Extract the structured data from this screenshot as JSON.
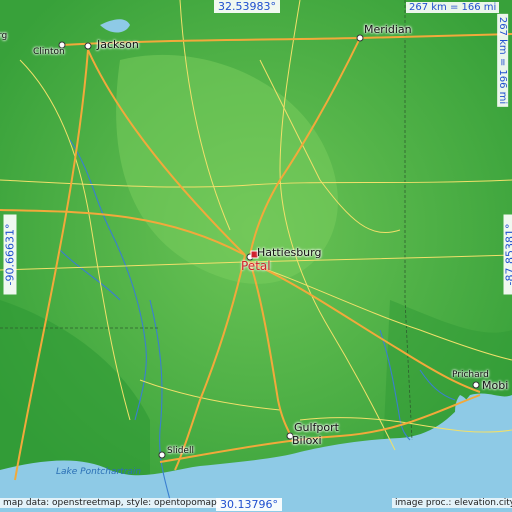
{
  "coordinates": {
    "top": "32.53983°",
    "bottom": "30.13796°",
    "left": "-90.66631°",
    "right": "-87.85381°"
  },
  "scale": {
    "horizontal": "267 km = 166 mi",
    "vertical": "267 km = 166 mi"
  },
  "cities": {
    "clinton": "Clinton",
    "jackson": "Jackson",
    "meridian": "Meridian",
    "hattiesburg": "Hattiesburg",
    "petal": "Petal",
    "prichard": "Prichard",
    "mobile": "Mobi",
    "gulfport": "Gulfport",
    "biloxi": "Biloxi",
    "slidell": "Slidell",
    "edge_top_left": "rg"
  },
  "water": {
    "lake_pontchartrain": "Lake Pontchartrain"
  },
  "credits": {
    "left": "map data: openstreetmap, style: opentopomap",
    "right": "image proc.: elevation.city"
  },
  "colors": {
    "land": "#3fa83f",
    "land_light": "#5fbf4a",
    "water": "#8ecae6",
    "highway": "#f2a93b",
    "road": "#f1e06a",
    "marker": "#d0212d",
    "coord_text": "#1f4fcf"
  }
}
